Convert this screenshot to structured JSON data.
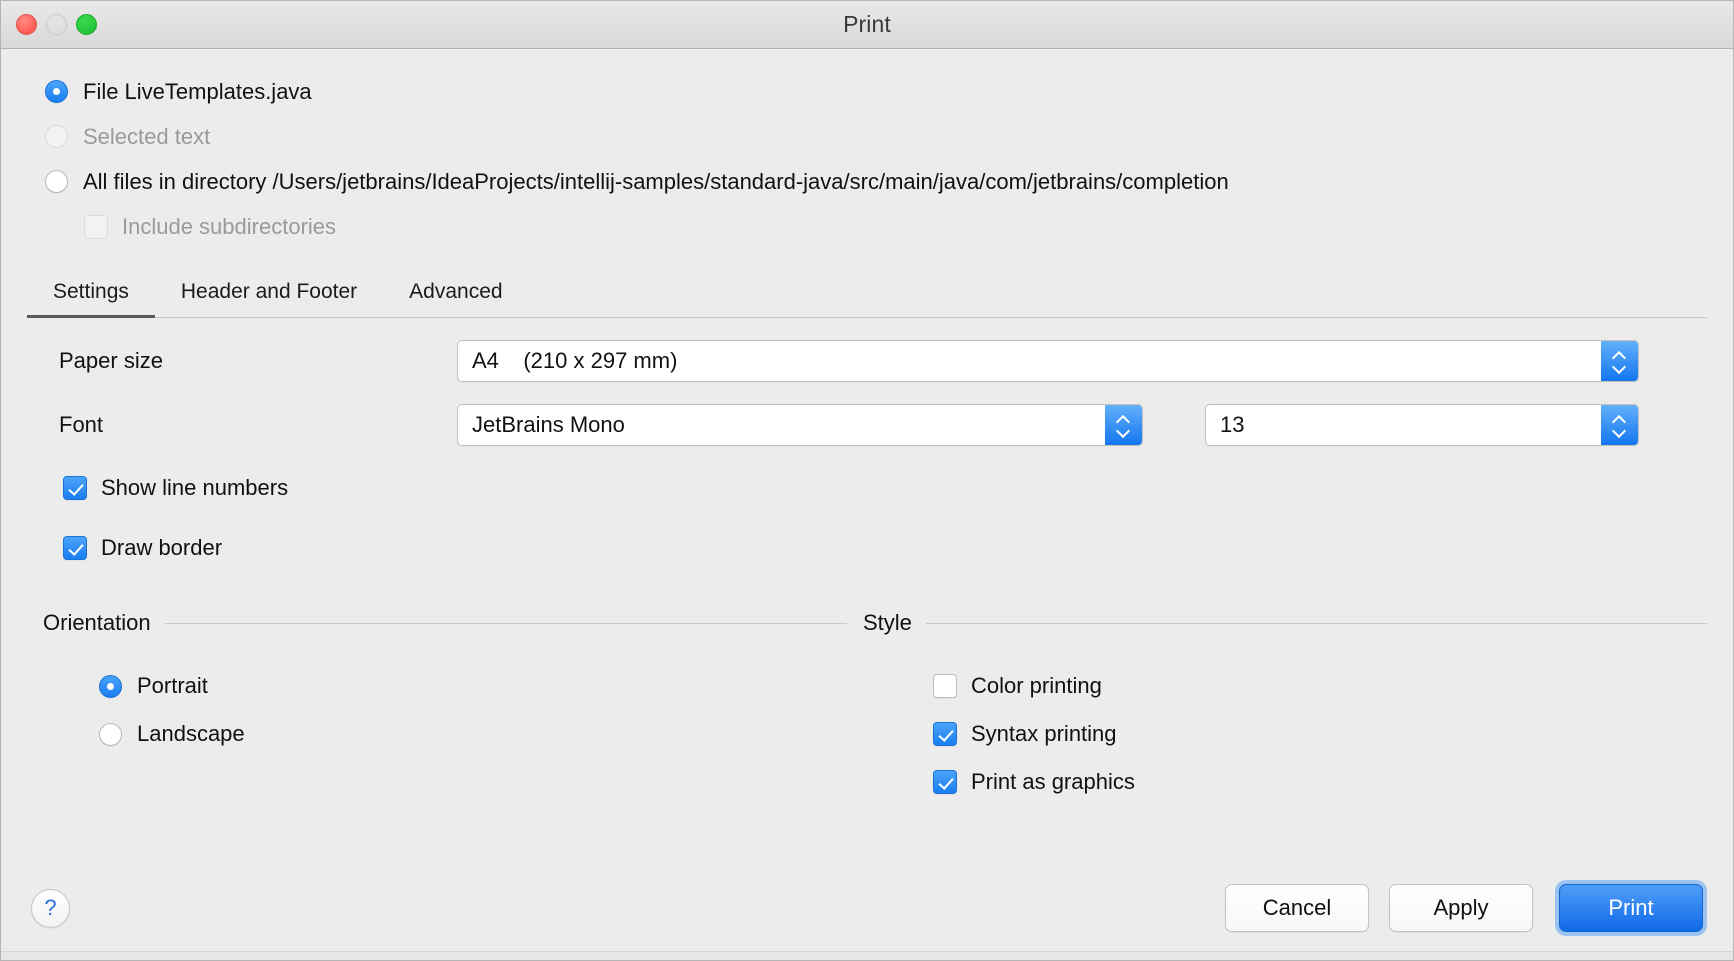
{
  "window": {
    "title": "Print",
    "traffic_lights": [
      "close-button",
      "minimize-button",
      "maximize-button"
    ]
  },
  "source": {
    "options": [
      {
        "label": "File LiveTemplates.java",
        "selected": true,
        "disabled": false
      },
      {
        "label": "Selected text",
        "selected": false,
        "disabled": true
      },
      {
        "label": "All files in directory /Users/jetbrains/IdeaProjects/intellij-samples/standard-java/src/main/java/com/jetbrains/completion",
        "selected": false,
        "disabled": false
      }
    ],
    "include_subdirectories": {
      "label": "Include subdirectories",
      "checked": false,
      "disabled": true
    }
  },
  "tabs": [
    {
      "label": "Settings",
      "active": true
    },
    {
      "label": "Header and Footer",
      "active": false
    },
    {
      "label": "Advanced",
      "active": false
    }
  ],
  "settings": {
    "paper_size": {
      "label": "Paper size",
      "value": "A4    (210 x 297 mm)"
    },
    "font": {
      "label": "Font",
      "value": "JetBrains Mono"
    },
    "font_size": {
      "value": "13"
    },
    "show_line_numbers": {
      "label": "Show line numbers",
      "checked": true
    },
    "draw_border": {
      "label": "Draw border",
      "checked": true
    }
  },
  "orientation": {
    "title": "Orientation",
    "options": [
      {
        "label": "Portrait",
        "selected": true
      },
      {
        "label": "Landscape",
        "selected": false
      }
    ]
  },
  "style": {
    "title": "Style",
    "options": [
      {
        "label": "Color printing",
        "checked": false
      },
      {
        "label": "Syntax printing",
        "checked": true
      },
      {
        "label": "Print as graphics",
        "checked": true
      }
    ]
  },
  "footer": {
    "help_label": "?",
    "cancel_label": "Cancel",
    "apply_label": "Apply",
    "print_label": "Print"
  },
  "colors": {
    "accent_blue": "#1a7ef0",
    "window_bg": "#ececec",
    "disabled_text": "#9a9a9a",
    "traffic_close": "#ff6159",
    "traffic_min": "#dedede",
    "traffic_max": "#27c93f"
  }
}
